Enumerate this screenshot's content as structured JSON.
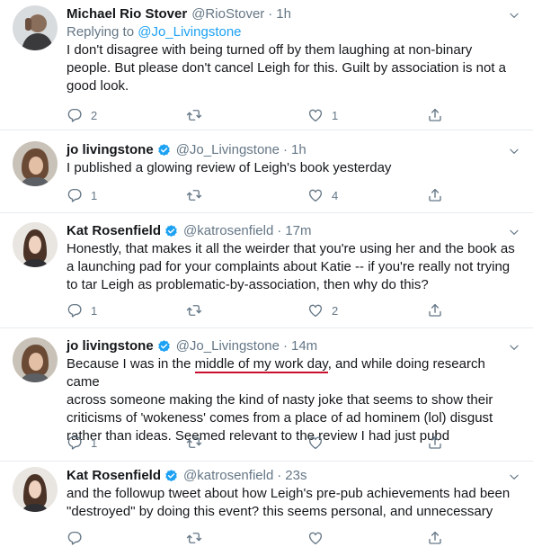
{
  "tweets": [
    {
      "name": "Michael Rio Stover",
      "verified": false,
      "handle": "@RioStover",
      "dot": "·",
      "time": "1h",
      "replying_prefix": "Replying to ",
      "replying_to": "@Jo_Livingstone",
      "text_lines": [
        "I don't disagree with being turned off by them laughing at non-binary",
        "people. But please don't cancel Leigh for this. Guilt by association is not a",
        "good look."
      ],
      "replies": "2",
      "retweets": "",
      "likes": "1"
    },
    {
      "name": "jo livingstone",
      "verified": true,
      "handle": "@Jo_Livingstone",
      "dot": "·",
      "time": "1h",
      "text_lines": [
        "I published a glowing review of Leigh's book yesterday"
      ],
      "replies": "1",
      "retweets": "",
      "likes": "4"
    },
    {
      "name": "Kat Rosenfield",
      "verified": true,
      "handle": "@katrosenfield",
      "dot": "·",
      "time": "17m",
      "text_lines": [
        "Honestly, that makes it all the weirder that you're using her and the book as",
        "a launching pad for your complaints about Katie -- if you're really not trying",
        "to tar Leigh as problematic-by-association, then why do this?"
      ],
      "replies": "1",
      "retweets": "",
      "likes": "2"
    },
    {
      "name": "jo livingstone",
      "verified": true,
      "handle": "@Jo_Livingstone",
      "dot": "·",
      "time": "14m",
      "text_line1_before": "Because I was in the ",
      "text_line1_underlined": "middle of my work day",
      "text_line1_after": ", and while doing research came",
      "text_lines": [
        "across someone making the kind of nasty joke that seems to show their",
        "criticisms of 'wokeness' comes from a place of ad hominem (lol) disgust",
        "rather than ideas. Seemed relevant to the review I had just pubd"
      ],
      "replies": "1",
      "retweets": "",
      "likes": ""
    },
    {
      "name": "Kat Rosenfield",
      "verified": true,
      "handle": "@katrosenfield",
      "dot": "·",
      "time": "23s",
      "text_lines": [
        "and the followup tweet about how Leigh's pre-pub achievements had been",
        "\"destroyed\" by doing this event? this seems personal, and unnecessary"
      ],
      "replies": "",
      "retweets": "",
      "likes": ""
    }
  ],
  "icons": {
    "reply": "reply-icon",
    "retweet": "retweet-icon",
    "like": "heart-icon",
    "share": "share-icon",
    "caret": "chevron-down-icon",
    "verified": "verified-badge-icon"
  },
  "colors": {
    "link": "#1da1f2",
    "secondary": "#657786",
    "underline": "#c8102e",
    "verified": "#1da1f2"
  }
}
